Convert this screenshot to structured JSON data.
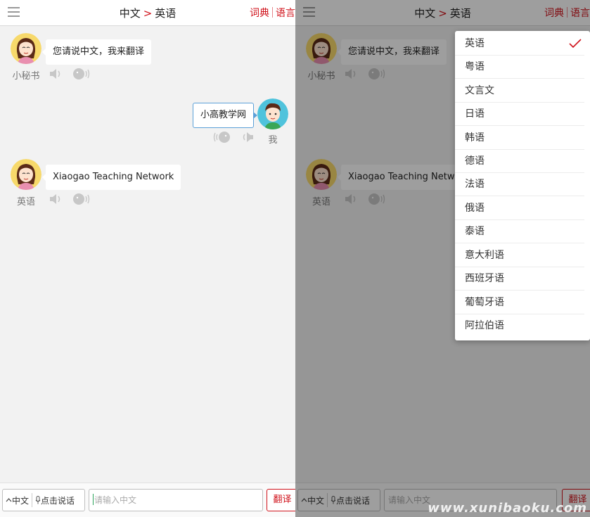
{
  "header": {
    "source_lang": "中文",
    "arrow": ">",
    "target_lang": "英语",
    "link_dictionary": "词典",
    "link_language": "语言"
  },
  "chat": {
    "messages": [
      {
        "speaker": "小秘书",
        "text": "您请说中文，我来翻译",
        "direction": "in"
      },
      {
        "speaker": "我",
        "text": "小高教学网",
        "direction": "out"
      },
      {
        "speaker": "英语",
        "text": "Xiaogao Teaching Network",
        "direction": "in"
      }
    ]
  },
  "bottom_bar": {
    "lang_toggle": "中文",
    "voice_button": "点击说话",
    "input_placeholder": "请输入中文",
    "translate_button": "翻译"
  },
  "dropdown": {
    "selected": "英语",
    "options": [
      "英语",
      "粤语",
      "文言文",
      "日语",
      "韩语",
      "德语",
      "法语",
      "俄语",
      "泰语",
      "意大利语",
      "西班牙语",
      "葡萄牙语",
      "阿拉伯语"
    ]
  },
  "watermark": "www.xunibaoku.com",
  "colors": {
    "accent": "#d0121b",
    "outgoing_border": "#5aa0d8",
    "background": "#f2f2f2"
  }
}
